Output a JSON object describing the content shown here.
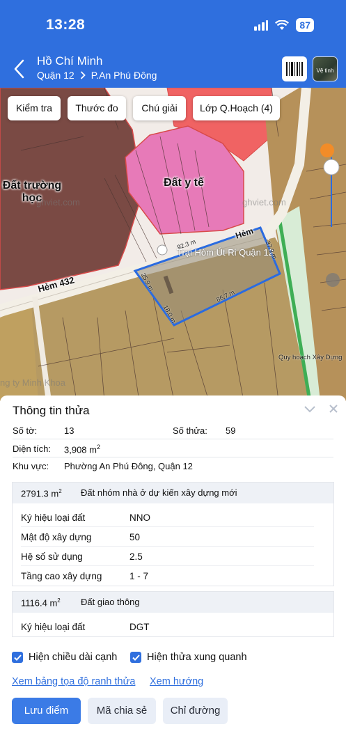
{
  "status": {
    "time": "13:28",
    "battery": "87"
  },
  "header": {
    "title": "Hồ Chí Minh",
    "district": "Quận 12",
    "ward": "P.An Phú Đông",
    "satellite_label": "Vệ tinh"
  },
  "map": {
    "buttons": {
      "check": "Kiểm tra",
      "measure": "Thước đo",
      "legend": "Chú giải",
      "layers": "Lớp Q.Hoạch (4)"
    },
    "labels": {
      "school": "Đất trường học",
      "medical": "Đất y tế",
      "alley_432": "Hẻm 432",
      "alley_top": "Hẻm",
      "place": "Trại Hòm Út Ri Quận 12",
      "planning": "Quy hoạch Xây Dựng",
      "company": "ng ty Minh Khoa"
    },
    "watermark": "ghviet.com",
    "edges": [
      "92.3 m",
      "37.9 m",
      "86.7 m",
      "18.0 m",
      "25.9 m"
    ]
  },
  "panel": {
    "title": "Thông tin thửa",
    "sheet_label": "Số tờ:",
    "sheet_value": "13",
    "parcel_label": "Số thửa:",
    "parcel_value": "59",
    "area_label": "Diện tích:",
    "area_value": "3,908 m",
    "area_sup": "2",
    "region_label": "Khu vực:",
    "region_value": "Phường An Phú Đông, Quận 12",
    "zones": [
      {
        "area": "2791.3 m",
        "area_sup": "2",
        "name": "Đất nhóm nhà ở dự kiến xây dựng mới",
        "rows": [
          {
            "k": "Ký hiệu loại đất",
            "v": "NNO"
          },
          {
            "k": "Mật độ xây dựng",
            "v": "50"
          },
          {
            "k": "Hệ số sử dụng",
            "v": "2.5"
          },
          {
            "k": "Tầng cao xây dựng",
            "v": "1 - 7"
          }
        ]
      },
      {
        "area": "1116.4 m",
        "area_sup": "2",
        "name": "Đất giao thông",
        "rows": [
          {
            "k": "Ký hiệu loại đất",
            "v": "DGT"
          }
        ]
      }
    ],
    "check_edges": "Hiện chiều dài cạnh",
    "check_neighbors": "Hiện thửa xung quanh",
    "link_coords": "Xem bảng tọa độ ranh thửa",
    "link_direction": "Xem hướng",
    "btn_save": "Lưu điểm",
    "btn_share": "Mã chia sẻ",
    "btn_route": "Chỉ đường"
  }
}
